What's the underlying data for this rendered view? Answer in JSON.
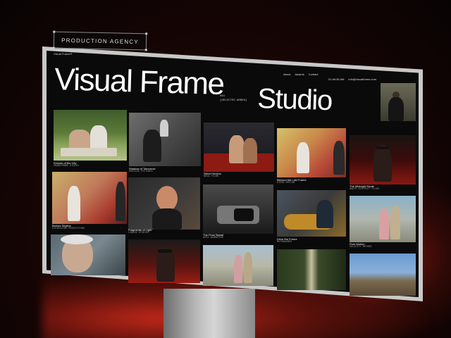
{
  "badge": {
    "label": "PRODUCTION AGENCY"
  },
  "site": {
    "logo": "Visual Frame®",
    "nav": [
      "About",
      "Awards",
      "Contact"
    ],
    "time": "01:46:36 AM",
    "email": "info@visualframe.com",
    "hero_line1": "Visual Frame",
    "hero_line2": "Studio",
    "selected_index": "001",
    "selected_label": "[SELECTED WORKS]"
  },
  "works": [
    {
      "title": "Echoes of the City",
      "studio": "GRANDFRAME STUDIO"
    },
    {
      "title": "Shadow of Tomorrow",
      "studio": "HORIZON PICTURES"
    },
    {
      "title": "Silent Horizon",
      "studio": "NOVA FILMS"
    },
    {
      "title": "Beyond the Last Frame",
      "studio": "ATLAS MOTION"
    },
    {
      "title": "The Midnight Route",
      "studio": "NORTH DISTRICT FILMS"
    },
    {
      "title": "Broken Skyline",
      "studio": "SILVERLINE PRODUCTIONS"
    },
    {
      "title": "Fragments of Light",
      "studio": "LONDON STUDIOS"
    },
    {
      "title": "The Final Signal",
      "studio": "APEX NARRATIVE"
    },
    {
      "title": "Drive the Future",
      "studio": "MOTORWORKS"
    },
    {
      "title": "Pure Motion",
      "studio": "VELOCITY MOTORS"
    }
  ],
  "colors": {
    "accent_red": "#c0281a",
    "screen_bg": "#0a0a0a",
    "bezel": "#c8c8c8"
  }
}
